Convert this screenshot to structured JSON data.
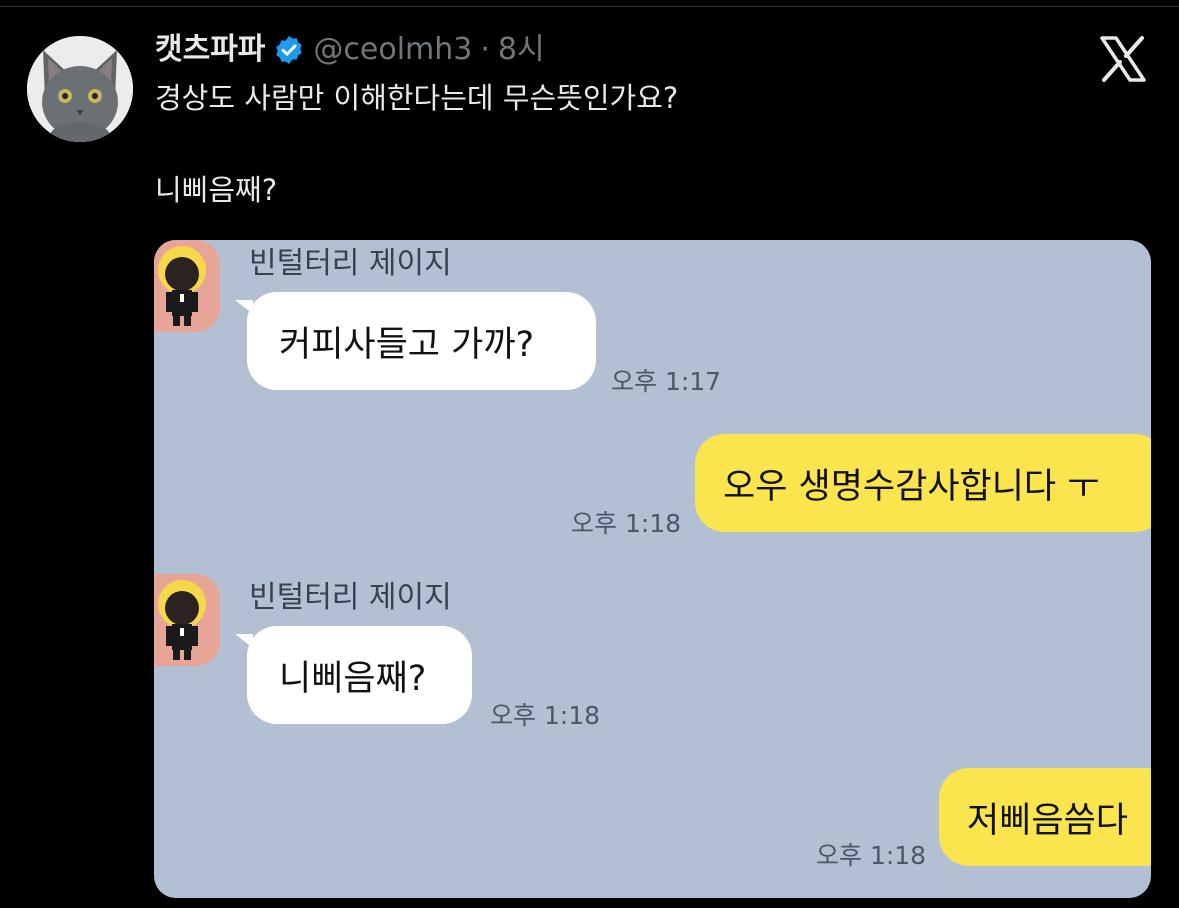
{
  "tweet": {
    "display_name": "캣츠파파",
    "handle": "@ceolmh3",
    "separator": "·",
    "time": "8시",
    "text_line1": "경상도 사람만 이해한다는데 무슨뜻인가요?",
    "text_line2": "니삐음째?",
    "avatar_icon": "cat-avatar-icon",
    "verified_icon": "verified-badge-icon",
    "brand_icon": "x-logo-icon",
    "verified_color": "#1d9bf0"
  },
  "chat": {
    "messages": [
      {
        "sender": "빈털터리 제이지",
        "text": "커피사들고 가까?",
        "time": "오후 1:17",
        "side": "left"
      },
      {
        "text": "오우 생명수감사합니다 ㅜ",
        "time": "오후 1:18",
        "side": "right"
      },
      {
        "sender": "빈털터리 제이지",
        "text": "니삐음째?",
        "time": "오후 1:18",
        "side": "left"
      },
      {
        "text": "저삐음씀다",
        "time": "오후 1:18",
        "side": "right"
      }
    ],
    "colors": {
      "background": "#b3c0d3",
      "incoming": "#ffffff",
      "outgoing": "#fbe54f"
    }
  }
}
